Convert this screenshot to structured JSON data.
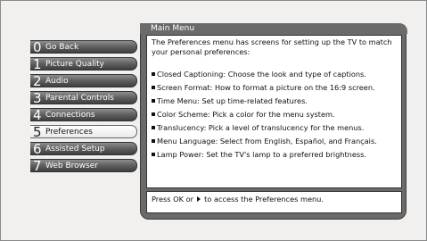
{
  "menu": {
    "items": [
      {
        "num": "0",
        "label": "Go Back",
        "selected": false
      },
      {
        "num": "1",
        "label": "Picture Quality",
        "selected": false
      },
      {
        "num": "2",
        "label": "Audio",
        "selected": false
      },
      {
        "num": "3",
        "label": "Parental Controls",
        "selected": false
      },
      {
        "num": "4",
        "label": "Connections",
        "selected": false
      },
      {
        "num": "5",
        "label": "Preferences",
        "selected": true
      },
      {
        "num": "6",
        "label": "Assisted Setup",
        "selected": false
      },
      {
        "num": "7",
        "label": "Web Browser",
        "selected": false
      }
    ]
  },
  "panel": {
    "title": "Main Menu",
    "intro": "The Preferences menu has screens for setting up the TV to match your personal preferences:",
    "bullets": [
      "Closed Captioning: Choose the look and type of captions.",
      "Screen Format: How to format a picture on the 16:9 screen.",
      "Time Menu: Set up time-related features.",
      "Color Scheme: Pick a color for the menu system.",
      "Translucency: Pick a level of translucency for the menus.",
      "Menu Language: Select from English, Español, and Français.",
      "Lamp Power: Set the TV's lamp to a preferred brightness."
    ],
    "footer_before": "Press OK or",
    "footer_after": "to access the Preferences menu."
  }
}
